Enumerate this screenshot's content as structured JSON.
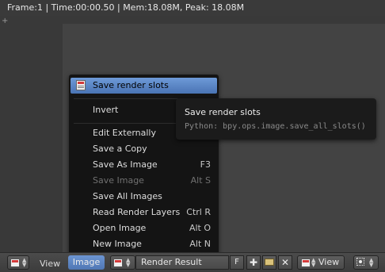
{
  "status_bar": {
    "text": "Frame:1 | Time:00:00.50 | Mem:18.08M, Peak: 18.08M"
  },
  "popup_menu": {
    "highlighted": "Save render slots",
    "items": [
      {
        "label": "Save render slots",
        "shortcut": ""
      },
      {
        "label": "Invert",
        "shortcut": ""
      },
      {
        "label": "Edit Externally",
        "shortcut": ""
      },
      {
        "label": "Save a Copy",
        "shortcut": ""
      },
      {
        "label": "Save As Image",
        "shortcut": "F3"
      },
      {
        "label": "Save Image",
        "shortcut": "Alt S",
        "disabled": true
      },
      {
        "label": "Save All Images",
        "shortcut": ""
      },
      {
        "label": "Read Render Layers",
        "shortcut": "Ctrl R"
      },
      {
        "label": "Open Image",
        "shortcut": "Alt O"
      },
      {
        "label": "New Image",
        "shortcut": "Alt N"
      }
    ]
  },
  "tooltip": {
    "title": "Save render slots",
    "python": "Python: bpy.ops.image.save_all_slots()"
  },
  "header": {
    "menus": {
      "view": "View",
      "image": "Image"
    },
    "image_name": "Render Result",
    "fake_user": "F",
    "new_icon": "plus-icon",
    "open_icon": "folder-icon",
    "unlink_icon": "close-icon",
    "view_mode": "View",
    "pivot_icon": "pivot-icon"
  },
  "colors": {
    "highlight": "#5a86c6",
    "image_menu_active": "#5f88c4",
    "menu_bg": "#141414",
    "tooltip_bg": "#1b1b1b"
  }
}
